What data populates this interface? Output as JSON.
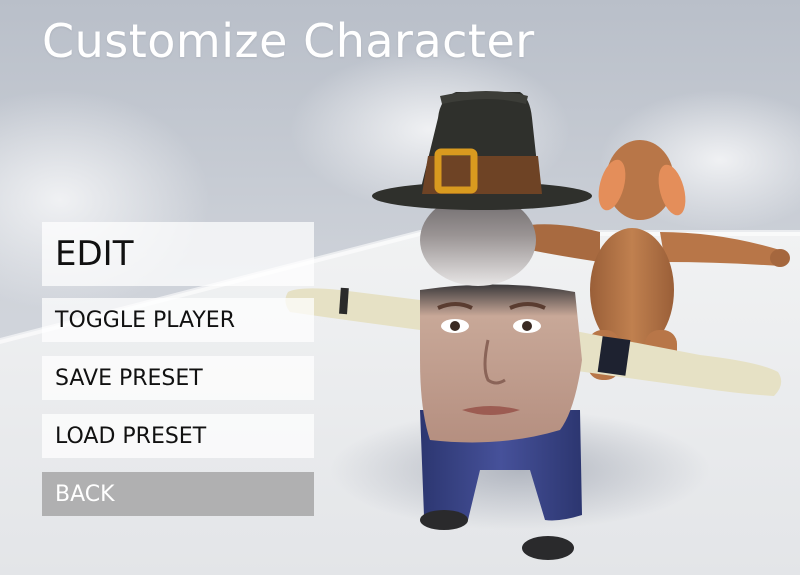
{
  "screen": {
    "title": "Customize Character"
  },
  "menu": {
    "items": [
      {
        "label": "EDIT"
      },
      {
        "label": "TOGGLE PLAYER"
      },
      {
        "label": "SAVE PRESET"
      },
      {
        "label": "LOAD PRESET"
      },
      {
        "label": "BACK"
      }
    ]
  },
  "colors": {
    "sky": "#c9ced6",
    "floor": "#eceef0",
    "hat": "#2f302c",
    "hat_band": "#6e4325",
    "buckle": "#d99a1f",
    "pants": "#3d4890",
    "arm_sleeve": "#e6e1c5",
    "bear_body": "#b87648",
    "bear_ear": "#e48e5a"
  }
}
